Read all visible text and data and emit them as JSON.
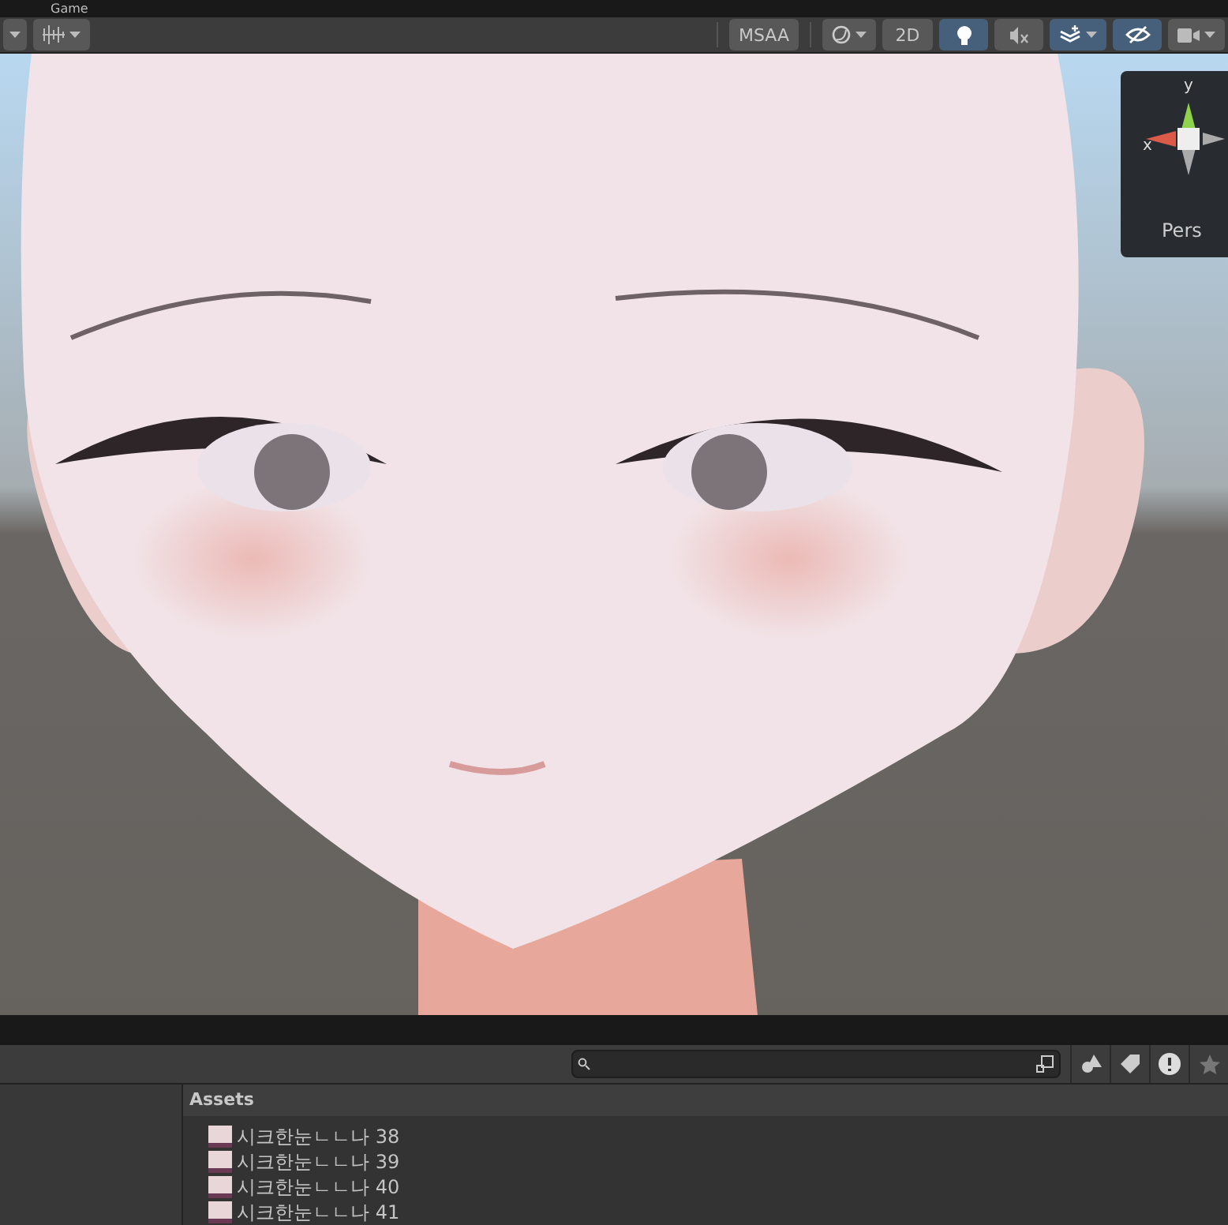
{
  "tabs": [
    {
      "label": "Game",
      "selected": false
    }
  ],
  "toolbar": {
    "msaa_label": "MSAA",
    "twod": {
      "label": "2D",
      "selected": false
    },
    "toggles": [
      {
        "kind": "lighting",
        "selected": true
      },
      {
        "kind": "audio",
        "selected": false
      },
      {
        "kind": "effects",
        "selected": true
      },
      {
        "kind": "visibility",
        "selected": true
      }
    ]
  },
  "gizmo": {
    "x_label": "x",
    "y_label": "y",
    "projection": "Pers"
  },
  "project": {
    "breadcrumb": "Assets",
    "assets": [
      {
        "name": "시크한눈ㄴㄴ나 38"
      },
      {
        "name": "시크한눈ㄴㄴ나 39"
      },
      {
        "name": "시크한눈ㄴㄴ나 40"
      },
      {
        "name": "시크한눈ㄴㄴ나 41"
      }
    ]
  }
}
